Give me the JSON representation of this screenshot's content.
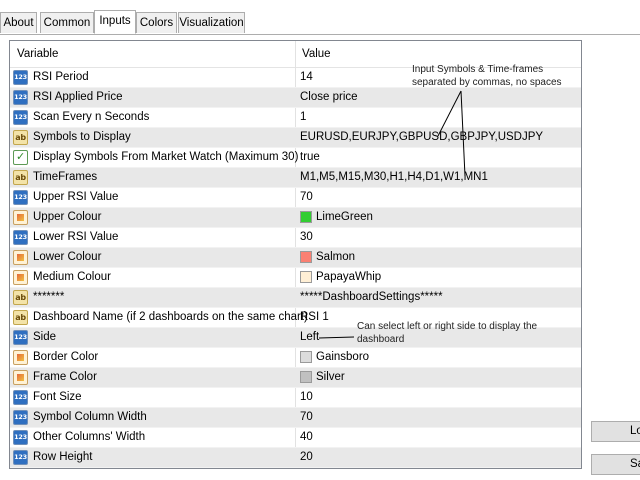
{
  "tabs": [
    "About",
    "Common",
    "Inputs",
    "Colors",
    "Visualization"
  ],
  "header": {
    "variable": "Variable",
    "value": "Value"
  },
  "rows": [
    {
      "type": "num",
      "name": "RSI Period",
      "value": "14"
    },
    {
      "type": "num",
      "name": "RSI Applied Price",
      "value": "Close price"
    },
    {
      "type": "num",
      "name": "Scan Every n Seconds",
      "value": "1"
    },
    {
      "type": "str",
      "name": "Symbols to Display",
      "value": "EURUSD,EURJPY,GBPUSD,GBPJPY,USDJPY"
    },
    {
      "type": "bool",
      "name": "Display Symbols From Market Watch (Maximum 30)",
      "value": "true"
    },
    {
      "type": "str",
      "name": "TimeFrames",
      "value": "M1,M5,M15,M30,H1,H4,D1,W1,MN1"
    },
    {
      "type": "num",
      "name": "Upper RSI Value",
      "value": "70"
    },
    {
      "type": "color",
      "name": "Upper Colour",
      "value": "LimeGreen",
      "swatch": "#32cd32"
    },
    {
      "type": "num",
      "name": "Lower RSI Value",
      "value": "30"
    },
    {
      "type": "color",
      "name": "Lower Colour",
      "value": "Salmon",
      "swatch": "#fa8072"
    },
    {
      "type": "color",
      "name": "Medium Colour",
      "value": "PapayaWhip",
      "swatch": "#ffefd5"
    },
    {
      "type": "str",
      "name": "*******",
      "value": "*****DashboardSettings*****"
    },
    {
      "type": "str",
      "name": "Dashboard Name (if 2 dashboards on the same chart)",
      "value": "RSI 1"
    },
    {
      "type": "num",
      "name": "Side",
      "value": "Left"
    },
    {
      "type": "color",
      "name": "Border Color",
      "value": "Gainsboro",
      "swatch": "#dcdcdc"
    },
    {
      "type": "color",
      "name": "Frame Color",
      "value": "Silver",
      "swatch": "#c0c0c0"
    },
    {
      "type": "num",
      "name": "Font Size",
      "value": "10"
    },
    {
      "type": "num",
      "name": "Symbol Column Width",
      "value": "70"
    },
    {
      "type": "num",
      "name": "Other Columns' Width",
      "value": "40"
    },
    {
      "type": "num",
      "name": "Row Height",
      "value": "20"
    }
  ],
  "icons": {
    "num": "123",
    "str": "ab",
    "bool": "✓",
    "color": "color-palette-icon"
  },
  "annotations": {
    "symbols_note": "Input Symbols & Time-frames separated by commas, no spaces",
    "side_note": "Can select left or right side to display the dashboard"
  },
  "buttons": {
    "top": "Lo",
    "bottom": "Sa"
  }
}
